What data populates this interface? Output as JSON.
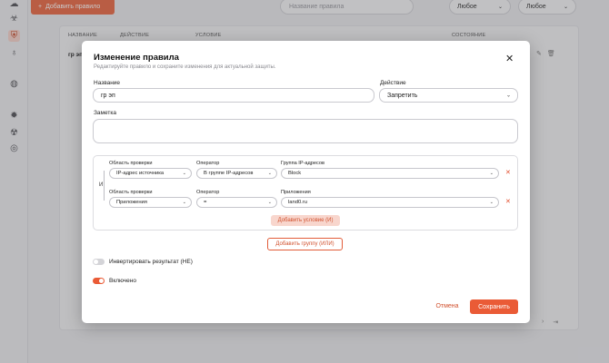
{
  "background": {
    "toolbar": {
      "add_rule_label": "Добавить правило",
      "search_placeholder": "Название правила",
      "filter1_value": "Любое",
      "filter2_value": "Любое"
    },
    "table": {
      "headers": [
        "НАЗВАНИЕ",
        "ДЕЙСТВИЕ",
        "УСЛОВИЕ",
        "СОСТОЯНИЕ"
      ],
      "rows": [
        {
          "name": "гр эп"
        }
      ]
    },
    "sidebar_icons": [
      "cloud-icon",
      "biohazard-icon",
      "rules-icon",
      "award-icon",
      "globe-icon",
      "settings-icon",
      "radiation-icon",
      "globe-icon"
    ]
  },
  "modal": {
    "title": "Изменение правила",
    "subtitle": "Редактируйте правило и сохраните изменения для актуальной защиты.",
    "name_label": "Название",
    "name_value": "гр эп",
    "action_label": "Действие",
    "action_value": "Запретить",
    "note_label": "Заметка",
    "note_value": "",
    "and_label": "И",
    "conditions": [
      {
        "scope_label": "Область проверки",
        "scope_value": "IP-адрес источника",
        "operator_label": "Оператор",
        "operator_value": "В группе IP-адресов",
        "value_label": "Группа IP-адресов",
        "value_value": "Block"
      },
      {
        "scope_label": "Область проверки",
        "scope_value": "Приложения",
        "operator_label": "Оператор",
        "operator_value": "=",
        "value_label": "Приложения",
        "value_value": "land0.ru"
      }
    ],
    "add_condition_label": "Добавить условие (И)",
    "add_group_label": "Добавить группу (ИЛИ)",
    "invert_label": "Инвертировать результат (НЕ)",
    "invert_on": false,
    "enabled_label": "Включено",
    "enabled_on": true,
    "cancel_label": "Отмена",
    "save_label": "Сохранить"
  },
  "colors": {
    "accent": "#ea5b36",
    "accent_light": "#f8d6cd",
    "delete": "#e24d2b"
  }
}
